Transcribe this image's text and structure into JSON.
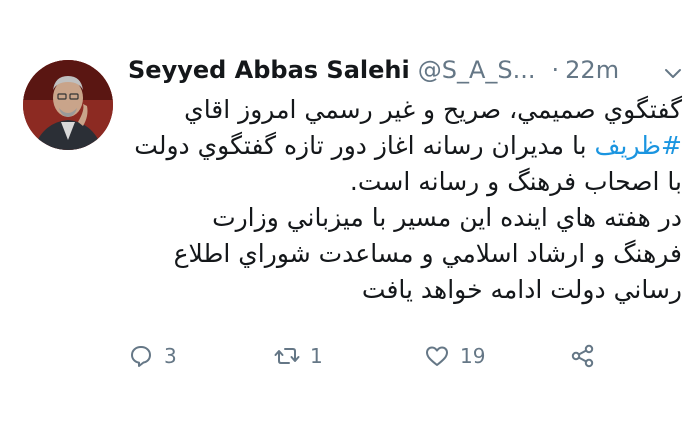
{
  "tweet": {
    "author_name": "Seyyed Abbas Salehi",
    "handle": "@S_A_S...",
    "separator": "·",
    "time": "22m",
    "text_part1": "گفتگوي صميمي، صريح و غير رسمي امروز اقاي",
    "hashtag": "#ظريف",
    "text_part2": " با مديران رسانه اغاز دور تازه گفتگوي دولت",
    "text_line3": "با اصحاب فرهنگ و رسانه است.",
    "text_line4": "در هفته هاي اينده  اين مسير با ميزباني وزارت",
    "text_line5": "فرهنگ و ارشاد اسلامي و مساعدت شوراي اطلاع",
    "text_line6": "رساني دولت ادامه خواهد يافت",
    "hashtag_color": "#1b95e0"
  },
  "actions": {
    "reply_count": "3",
    "retweet_count": "1",
    "like_count": "19",
    "share_icon": "share-icon"
  },
  "colors": {
    "text": "#14171a",
    "secondary": "#657786",
    "link": "#1b95e0"
  }
}
